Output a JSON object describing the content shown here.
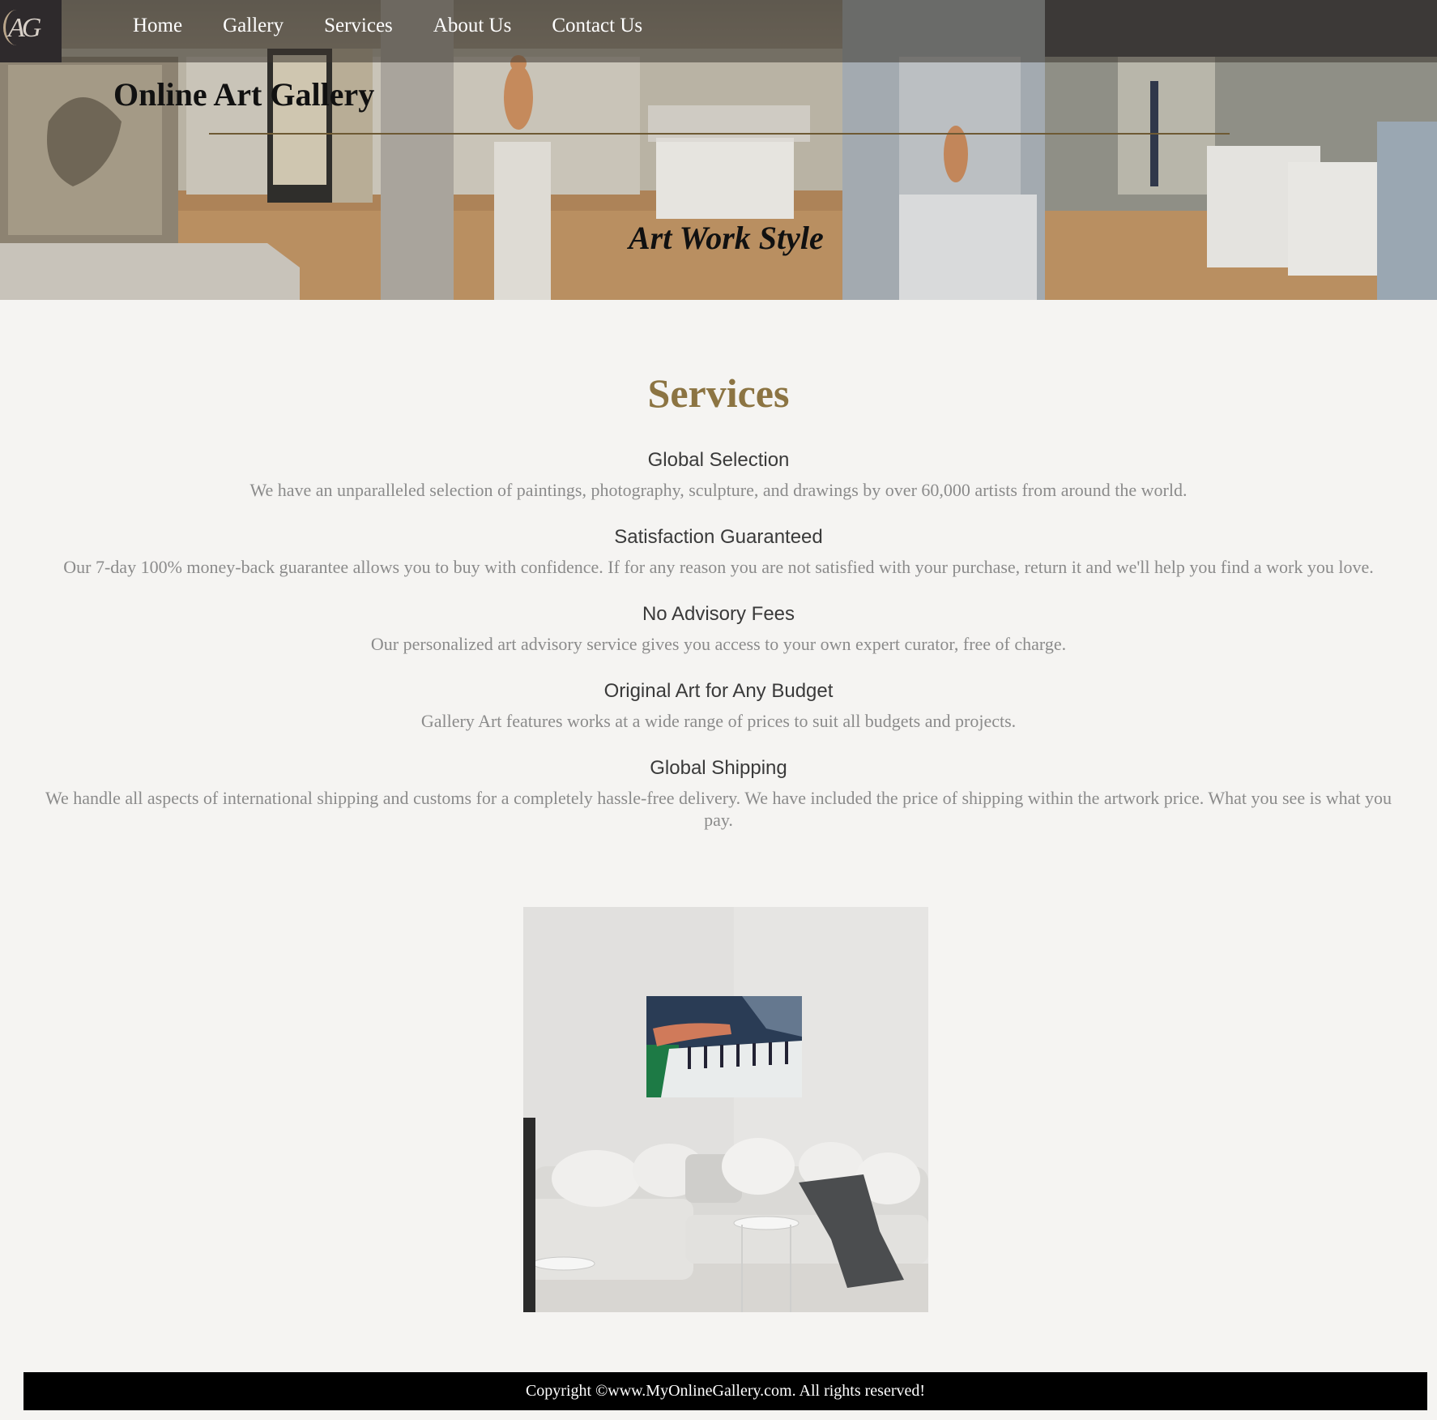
{
  "nav": {
    "logo_text": "AG",
    "items": [
      {
        "label": "Home"
      },
      {
        "label": "Gallery"
      },
      {
        "label": "Services"
      },
      {
        "label": "About Us"
      },
      {
        "label": "Contact Us"
      }
    ]
  },
  "hero": {
    "title": "Online Art Gallery",
    "tagline": "Art Work Style"
  },
  "main": {
    "title": "Services",
    "services": [
      {
        "heading": "Global Selection",
        "text": "We have an unparalleled selection of paintings, photography, sculpture, and drawings by over 60,000 artists from around the world."
      },
      {
        "heading": "Satisfaction Guaranteed",
        "text": "Our 7-day 100% money-back guarantee allows you to buy with confidence. If for any reason you are not satisfied with your purchase, return it and we'll help you find a work you love."
      },
      {
        "heading": "No Advisory Fees",
        "text": "Our personalized art advisory service gives you access to your own expert curator, free of charge."
      },
      {
        "heading": "Original Art for Any Budget",
        "text": "Gallery Art features works at a wide range of prices to suit all budgets and projects."
      },
      {
        "heading": "Global Shipping",
        "text": "We handle all aspects of international shipping and customs for a completely hassle-free delivery. We have included the price of shipping within the artwork price. What you see is what you pay."
      }
    ]
  },
  "footer": {
    "copyright": "Copyright ©www.MyOnlineGallery.com. All rights reserved!"
  },
  "colors": {
    "accent": "#8c7442",
    "footer_bg": "#000000",
    "page_bg": "#f5f4f2"
  }
}
